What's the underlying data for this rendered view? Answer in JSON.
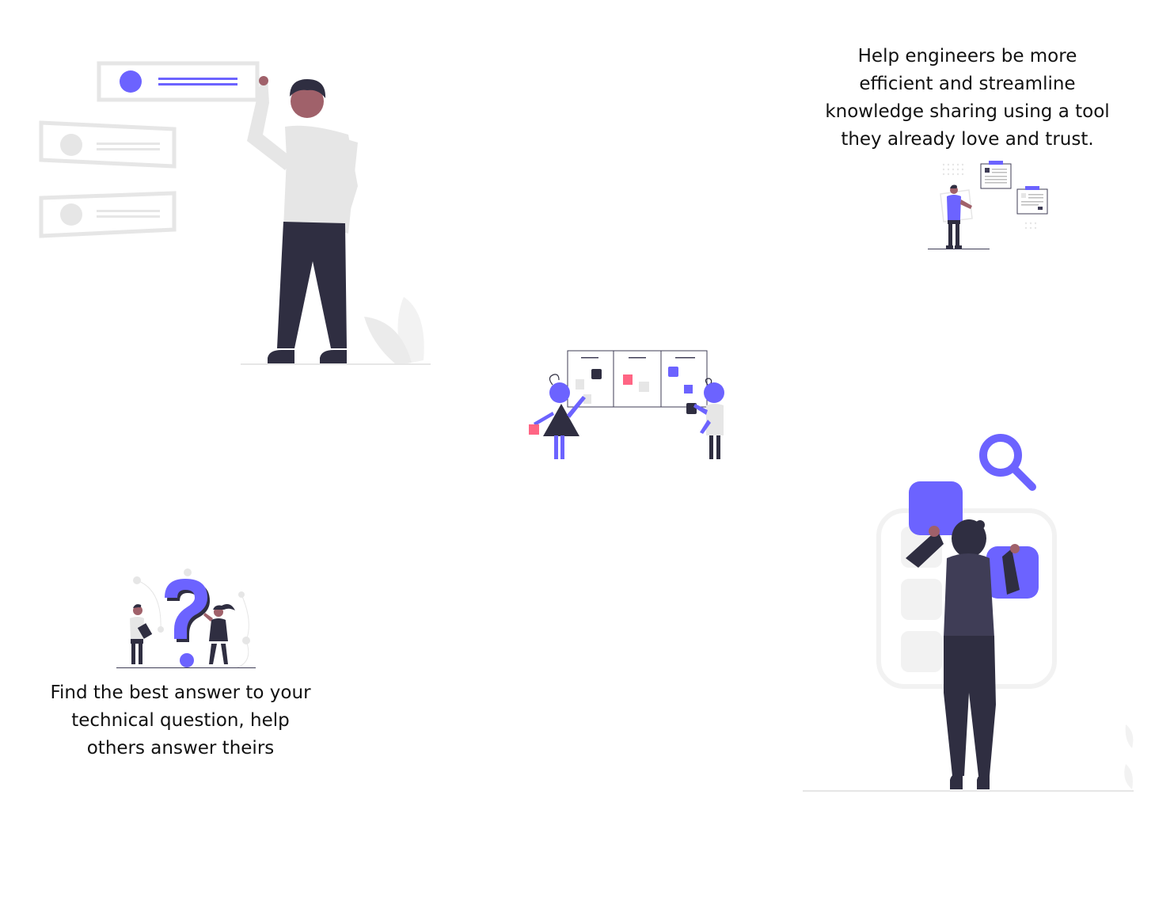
{
  "captions": {
    "top_right": "Help engineers be more efficient and streamline knowledge sharing using a tool they already love and trust.",
    "bottom_left": "Find the best answer to your technical question, help others answer theirs"
  },
  "colors": {
    "accent": "#6c63ff",
    "dark": "#2f2e41",
    "light_gray": "#e6e6e6",
    "skin": "#a0616a",
    "pink": "#ff6584"
  },
  "illustrations": [
    "man-with-cards-illustration",
    "small-reader-with-documents-illustration",
    "kanban-board-illustration",
    "question-mark-people-illustration",
    "woman-with-blocks-illustration"
  ]
}
